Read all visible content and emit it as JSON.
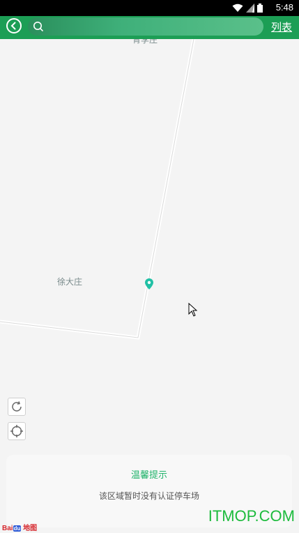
{
  "status_bar": {
    "time": "5:48",
    "icons": [
      "wifi-icon",
      "signal-icon",
      "battery-icon"
    ]
  },
  "top_bar": {
    "back_icon": "chevron-left-icon",
    "search_placeholder": "",
    "list_label": "列表",
    "background": "#1c9e55"
  },
  "map": {
    "labels": {
      "top": "青李庄",
      "mid": "徐大庄"
    },
    "marker_color": "#21c0a5",
    "controls": [
      "refresh-icon",
      "locate-icon"
    ],
    "logo": "Bai du 地图"
  },
  "notice_card": {
    "title": "温馨提示",
    "message": "该区域暂时没有认证停车场"
  },
  "watermark": "ITMOP.COM",
  "accent_color": "#21b36b"
}
